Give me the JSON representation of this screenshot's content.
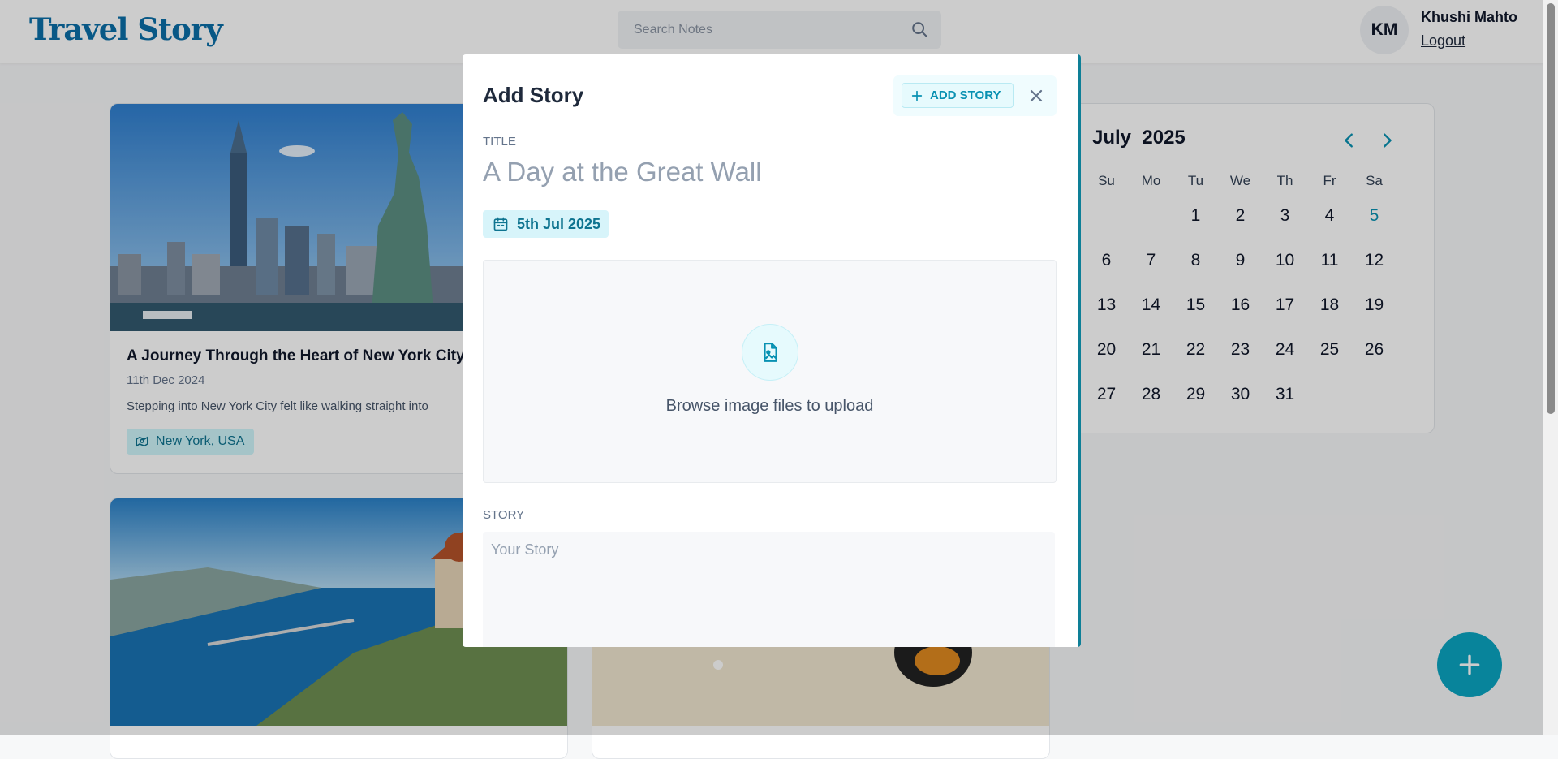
{
  "navbar": {
    "logo": "Travel Story",
    "search_placeholder": "Search Notes",
    "avatar_initials": "KM",
    "user_name": "Khushi Mahto",
    "logout_label": "Logout"
  },
  "cards": [
    {
      "title": "A Journey Through the Heart of New York City",
      "date": "11th Dec 2024",
      "excerpt": "Stepping into New York City felt like walking straight into",
      "location": "New York, USA"
    }
  ],
  "calendar": {
    "month": "July",
    "year": "2025",
    "weekdays": [
      "Su",
      "Mo",
      "Tu",
      "We",
      "Th",
      "Fr",
      "Sa"
    ],
    "weeks": [
      [
        "",
        "",
        "1",
        "2",
        "3",
        "4",
        "5"
      ],
      [
        "6",
        "7",
        "8",
        "9",
        "10",
        "11",
        "12"
      ],
      [
        "13",
        "14",
        "15",
        "16",
        "17",
        "18",
        "19"
      ],
      [
        "20",
        "21",
        "22",
        "23",
        "24",
        "25",
        "26"
      ],
      [
        "27",
        "28",
        "29",
        "30",
        "31",
        "",
        ""
      ]
    ],
    "selected_day": "5"
  },
  "modal": {
    "heading": "Add Story",
    "add_button_label": "ADD STORY",
    "title_label": "TITLE",
    "title_placeholder": "A Day at the Great Wall",
    "date_chip": "5th Jul 2025",
    "upload_text": "Browse image files to upload",
    "story_label": "STORY",
    "story_placeholder": "Your Story"
  },
  "colors": {
    "brand": "#0b6fa8",
    "accent": "#0aa5c2",
    "overlay": "rgba(0,0,0,0.2)"
  },
  "icons": [
    "search-icon",
    "location-icon",
    "calendar-icon",
    "image-upload-icon",
    "plus-icon",
    "close-icon",
    "chevron-left-icon",
    "chevron-right-icon"
  ]
}
